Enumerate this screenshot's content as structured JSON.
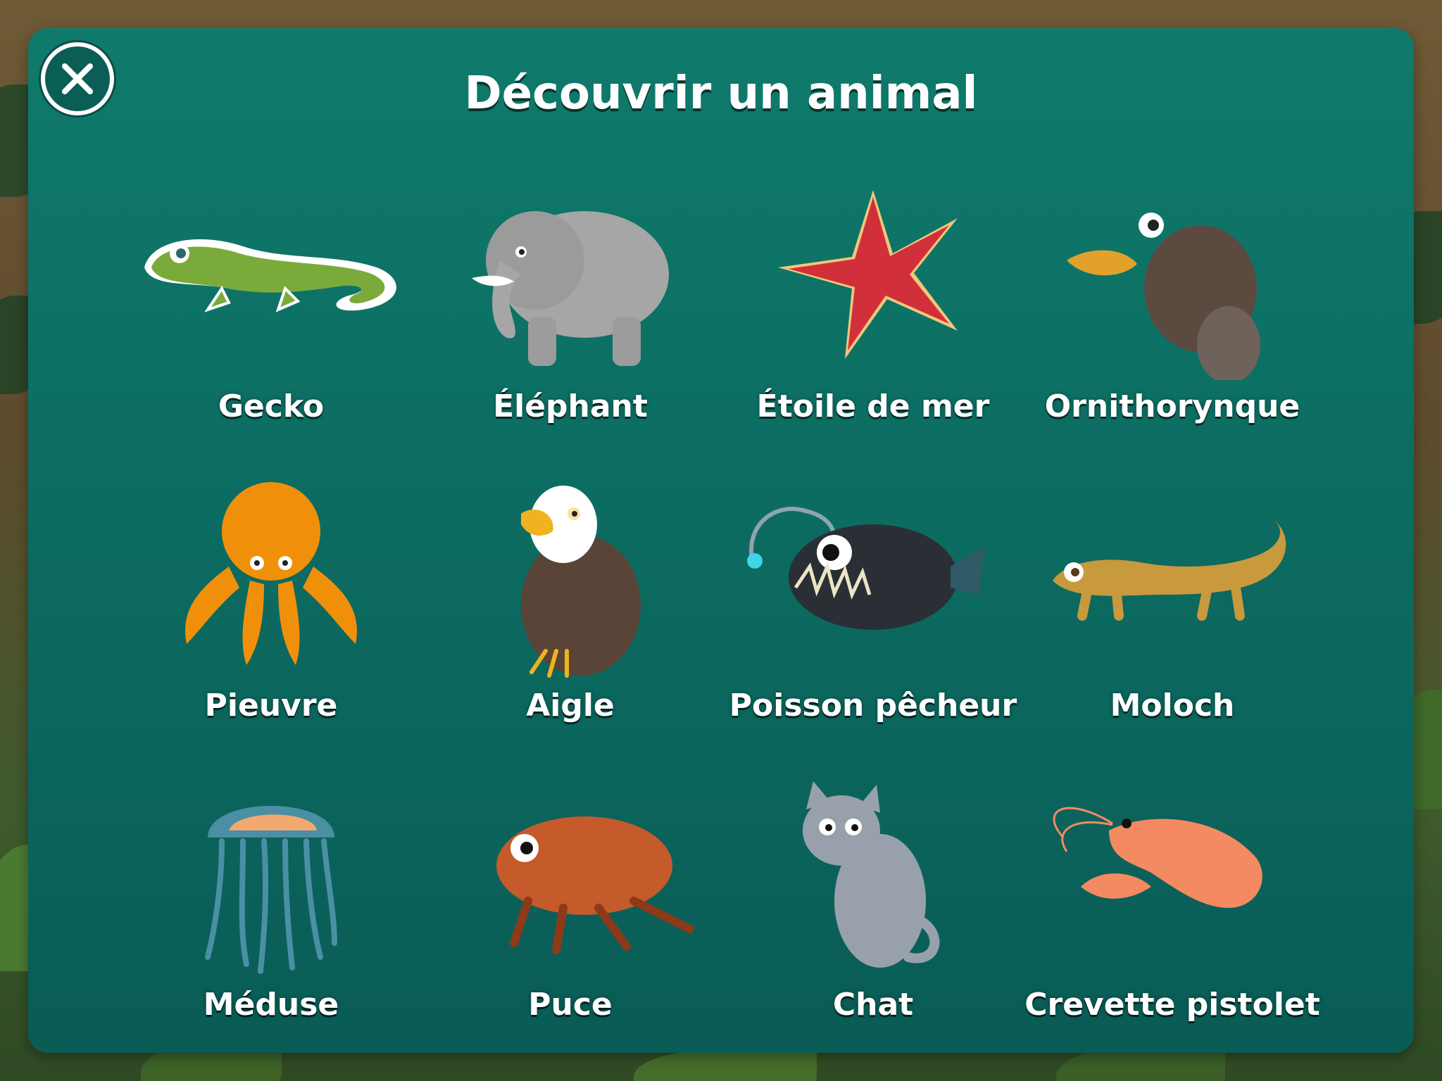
{
  "header": {
    "title": "Découvrir un animal"
  },
  "close_button": {
    "icon": "close-icon"
  },
  "animals": [
    {
      "name": "Gecko"
    },
    {
      "name": "Éléphant"
    },
    {
      "name": "Étoile de mer"
    },
    {
      "name": "Ornithorynque"
    },
    {
      "name": "Pieuvre"
    },
    {
      "name": "Aigle"
    },
    {
      "name": "Poisson pêcheur"
    },
    {
      "name": "Moloch"
    },
    {
      "name": "Méduse"
    },
    {
      "name": "Puce"
    },
    {
      "name": "Chat"
    },
    {
      "name": "Crevette pistolet"
    }
  ]
}
